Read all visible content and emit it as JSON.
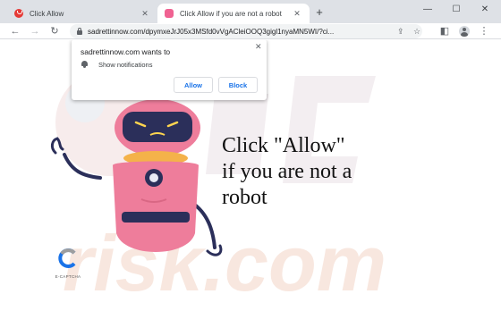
{
  "tabs": [
    {
      "title": "Click Allow"
    },
    {
      "title": "Click Allow if you are not a robot"
    }
  ],
  "tab_close_glyph": "✕",
  "new_tab_glyph": "+",
  "window_controls": {
    "minimize": "—",
    "maximize": "☐",
    "close": "✕"
  },
  "toolbar": {
    "back": "←",
    "forward": "→",
    "reload": "↻",
    "url": "sadrettinnow.com/dpymxeJrJ05x3MSfd0vVgACleiOOQ3gigl1nyaMN5WI/?ci...",
    "share": "⇪",
    "bookmark": "☆",
    "sidepanel": "◧",
    "menu": "⋮"
  },
  "page": {
    "headline": "Click \"Allow\"\nif you are not a\nrobot",
    "watermark_text": "risk.com",
    "captcha_label": "E-CAPTCHA"
  },
  "popup": {
    "title": "sadrettinnow.com wants to",
    "permission": "Show notifications",
    "close": "✕",
    "allow": "Allow",
    "block": "Block"
  },
  "colors": {
    "tabstrip": "#dee1e6",
    "link_blue": "#1a73e8",
    "robot_pink": "#ee7d9b",
    "robot_navy": "#2b2f5a",
    "watermark_orange": "#f6e3da"
  },
  "icons": [
    "red-favicon-icon",
    "pink-favicon-icon",
    "back-arrow-icon",
    "forward-arrow-icon",
    "reload-icon",
    "lock-icon",
    "share-icon",
    "bookmark-star-icon",
    "side-panel-icon",
    "profile-icon",
    "menu-icon",
    "bell-icon",
    "close-icon",
    "captcha-logo-icon"
  ]
}
